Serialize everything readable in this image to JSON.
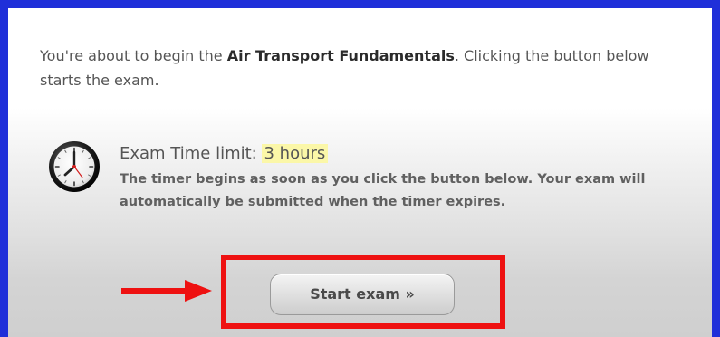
{
  "intro": {
    "prefix": "You're about to begin the ",
    "exam_name": "Air Transport Fundamentals",
    "suffix": ". Clicking the button below starts the exam."
  },
  "time_limit": {
    "label": "Exam Time limit:",
    "value": "3 hours",
    "highlight_color": "#fbf7a8",
    "description": "The timer begins as soon as you click the button below. Your exam will automatically be submitted when the timer expires.",
    "icon": "clock-icon"
  },
  "start_button": {
    "label": "Start exam »"
  },
  "annotations": {
    "arrow_icon": "red-arrow-icon",
    "highlight_box_color": "#ee1111",
    "frame_color": "#1f2fd9"
  }
}
